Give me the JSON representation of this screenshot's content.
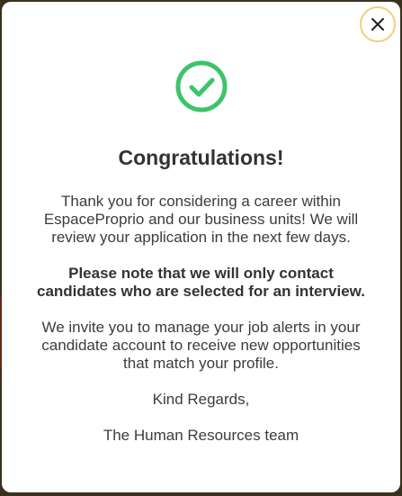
{
  "modal": {
    "title": "Congratulations!",
    "close_icon": "close-icon",
    "success_icon": "check-circle-icon",
    "paragraphs": {
      "thanks": "Thank you for considering a career within EspaceProprio and our business units! We will review your application in the next few days.",
      "notice": "Please note that we will only contact candidates who are selected for an interview.",
      "invite": "We invite you to manage your job alerts in your candidate account to receive new opportunities that match your profile.",
      "regards": "Kind Regards,",
      "signature": "The Human Resources team"
    }
  },
  "colors": {
    "success": "#3cc46a",
    "close_border": "#f2cf7a",
    "text": "#333333"
  }
}
